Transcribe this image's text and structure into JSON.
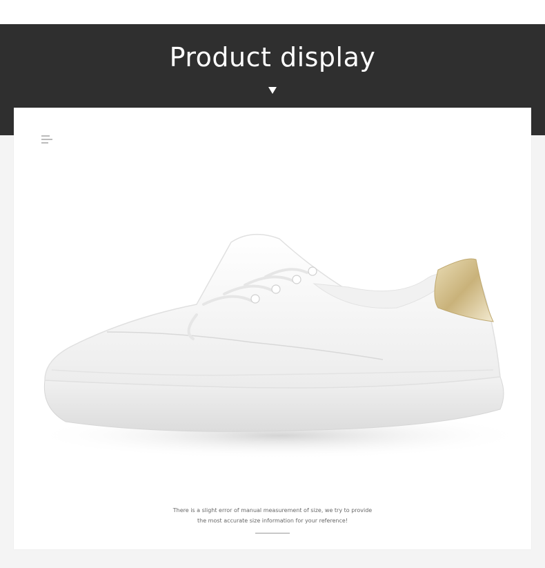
{
  "banner": {
    "title": "Product display",
    "arrow_icon": "triangle-down-icon"
  },
  "card": {
    "menu_icon": "hamburger-menu-icon",
    "image_alt": "white sneaker with gold heel tab",
    "note_line1": "There is a slight error of manual measurement of size, we try to provide",
    "note_line2": "the most accurate size information for your reference!"
  },
  "colors": {
    "banner_bg": "#2f2f2f",
    "page_bg": "#f4f4f4",
    "card_bg": "#ffffff",
    "accent_gold": "#c9b27a"
  }
}
